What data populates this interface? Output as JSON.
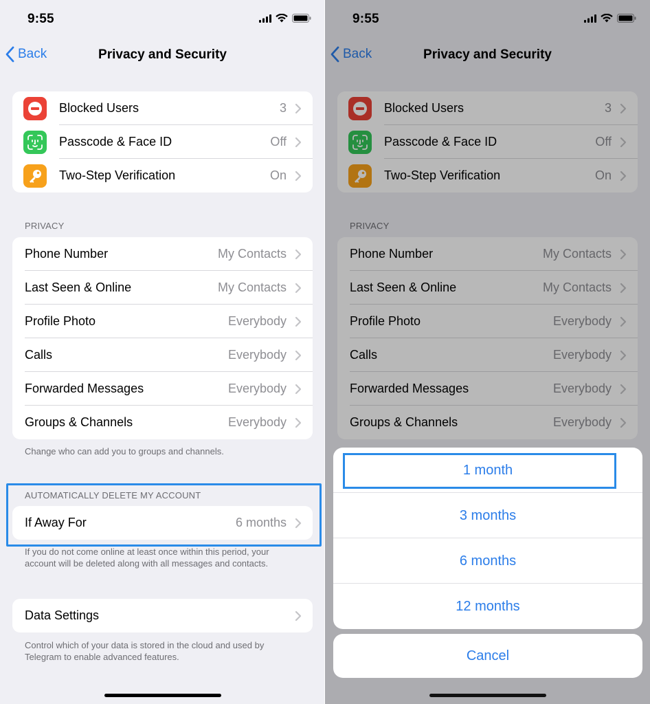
{
  "status": {
    "time": "9:55"
  },
  "nav": {
    "back_label": "Back",
    "title": "Privacy and Security"
  },
  "security": {
    "items": [
      {
        "label": "Blocked Users",
        "value": "3",
        "icon": "blocked-users-icon",
        "color": "#eb4236"
      },
      {
        "label": "Passcode & Face ID",
        "value": "Off",
        "icon": "face-id-icon",
        "color": "#34c759"
      },
      {
        "label": "Two-Step Verification",
        "value": "On",
        "icon": "key-icon",
        "color": "#f7a11b"
      }
    ]
  },
  "privacy": {
    "header": "PRIVACY",
    "items": [
      {
        "label": "Phone Number",
        "value": "My Contacts"
      },
      {
        "label": "Last Seen & Online",
        "value": "My Contacts"
      },
      {
        "label": "Profile Photo",
        "value": "Everybody"
      },
      {
        "label": "Calls",
        "value": "Everybody"
      },
      {
        "label": "Forwarded Messages",
        "value": "Everybody"
      },
      {
        "label": "Groups & Channels",
        "value": "Everybody"
      }
    ],
    "footer": "Change who can add you to groups and channels."
  },
  "auto_delete": {
    "header": "AUTOMATICALLY DELETE MY ACCOUNT",
    "label": "If Away For",
    "value": "6 months",
    "footer": "If you do not come online at least once within this period, your account will be deleted along with all messages and contacts."
  },
  "data_settings": {
    "label": "Data Settings",
    "footer": "Control which of your data is stored in the cloud and used by Telegram to enable advanced features."
  },
  "action_sheet": {
    "options": [
      "1 month",
      "3 months",
      "6 months",
      "12 months"
    ],
    "cancel": "Cancel",
    "accent": "#2b7de9"
  }
}
